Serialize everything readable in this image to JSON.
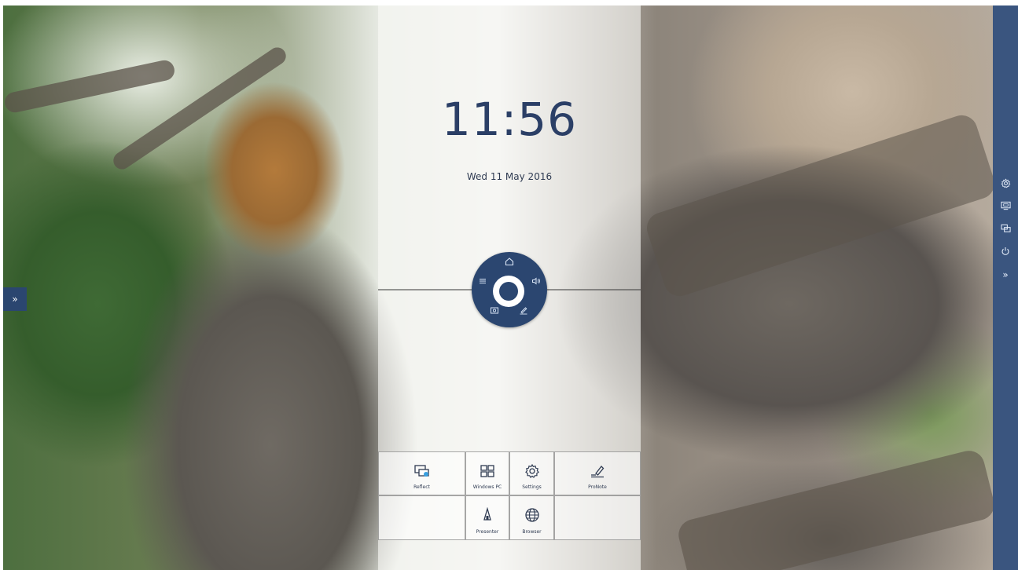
{
  "clock": {
    "time": "11:56",
    "date": "Wed 11 May 2016"
  },
  "left_handle": {
    "icon": "double-chevron-right-icon",
    "label": "»"
  },
  "radial_menu": {
    "items": [
      {
        "name": "home",
        "icon": "home-icon"
      },
      {
        "name": "volume",
        "icon": "speaker-icon"
      },
      {
        "name": "annotate",
        "icon": "pen-icon"
      },
      {
        "name": "screenshot",
        "icon": "screenshot-icon"
      },
      {
        "name": "menu",
        "icon": "menu-icon"
      }
    ]
  },
  "tiles": [
    {
      "label": "Reflect",
      "icon": "reflect-icon"
    },
    {
      "label": "Windows PC",
      "icon": "windows-icon"
    },
    {
      "label": "Settings",
      "icon": "gear-icon"
    },
    {
      "label": "ProNote",
      "icon": "pronote-icon"
    },
    {
      "label": "Presenter",
      "icon": "presenter-icon"
    },
    {
      "label": "Browser",
      "icon": "globe-icon"
    }
  ],
  "right_sidebar": {
    "items": [
      {
        "name": "settings",
        "icon": "gear-icon"
      },
      {
        "name": "source",
        "icon": "source-icon"
      },
      {
        "name": "reflect",
        "icon": "reflect-icon"
      },
      {
        "name": "power",
        "icon": "power-icon"
      },
      {
        "name": "expand",
        "icon": "double-chevron-right-icon",
        "label": "»"
      }
    ]
  },
  "colors": {
    "accent": "#2b4670",
    "sidebar": "#3a557f",
    "clock_text": "#2b3f66"
  }
}
